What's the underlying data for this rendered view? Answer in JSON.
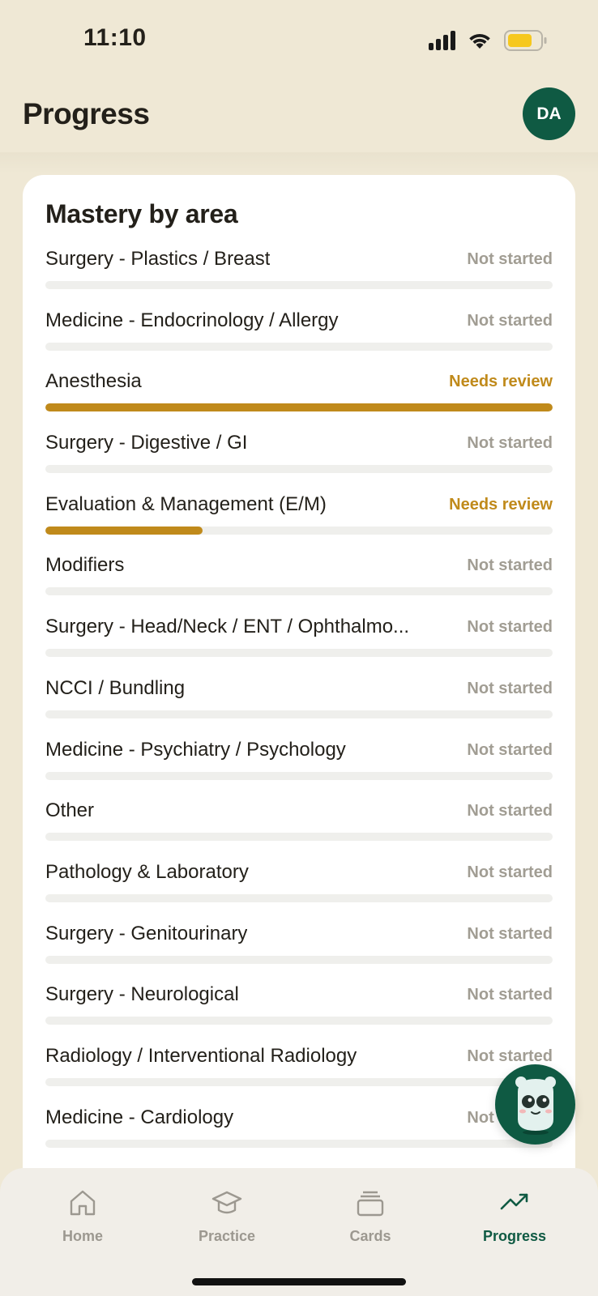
{
  "status_bar": {
    "time": "11:10",
    "battery_color": "#F6C81E"
  },
  "header": {
    "title": "Progress",
    "avatar_initials": "DA"
  },
  "mastery": {
    "title": "Mastery by area",
    "areas": [
      {
        "name": "Surgery - Plastics / Breast",
        "status": "Not started",
        "progress": 0
      },
      {
        "name": "Medicine - Endocrinology / Allergy",
        "status": "Not started",
        "progress": 0
      },
      {
        "name": "Anesthesia",
        "status": "Needs review",
        "progress": 1.0
      },
      {
        "name": "Surgery - Digestive / GI",
        "status": "Not started",
        "progress": 0
      },
      {
        "name": "Evaluation & Management (E/M)",
        "status": "Needs review",
        "progress": 0.31
      },
      {
        "name": "Modifiers",
        "status": "Not started",
        "progress": 0
      },
      {
        "name": "Surgery - Head/Neck / ENT / Ophthalmo...",
        "status": "Not started",
        "progress": 0
      },
      {
        "name": "NCCI / Bundling",
        "status": "Not started",
        "progress": 0
      },
      {
        "name": "Medicine - Psychiatry / Psychology",
        "status": "Not started",
        "progress": 0
      },
      {
        "name": "Other",
        "status": "Not started",
        "progress": 0
      },
      {
        "name": "Pathology & Laboratory",
        "status": "Not started",
        "progress": 0
      },
      {
        "name": "Surgery - Genitourinary",
        "status": "Not started",
        "progress": 0
      },
      {
        "name": "Surgery - Neurological",
        "status": "Not started",
        "progress": 0
      },
      {
        "name": "Radiology / Interventional Radiology",
        "status": "Not started",
        "progress": 0
      },
      {
        "name": "Medicine - Cardiology",
        "status": "Not started",
        "progress": 0
      }
    ]
  },
  "tab_bar": {
    "tabs": [
      {
        "label": "Home",
        "icon": "home-icon",
        "active": false
      },
      {
        "label": "Practice",
        "icon": "graduation-cap-icon",
        "active": false
      },
      {
        "label": "Cards",
        "icon": "cards-stack-icon",
        "active": false
      },
      {
        "label": "Progress",
        "icon": "trending-up-icon",
        "active": true
      }
    ]
  },
  "colors": {
    "background": "#EFE8D5",
    "brand_green": "#0F5A43",
    "needs_review": "#C08A1B",
    "not_started": "#A19D93",
    "track": "#EFEFEC"
  }
}
